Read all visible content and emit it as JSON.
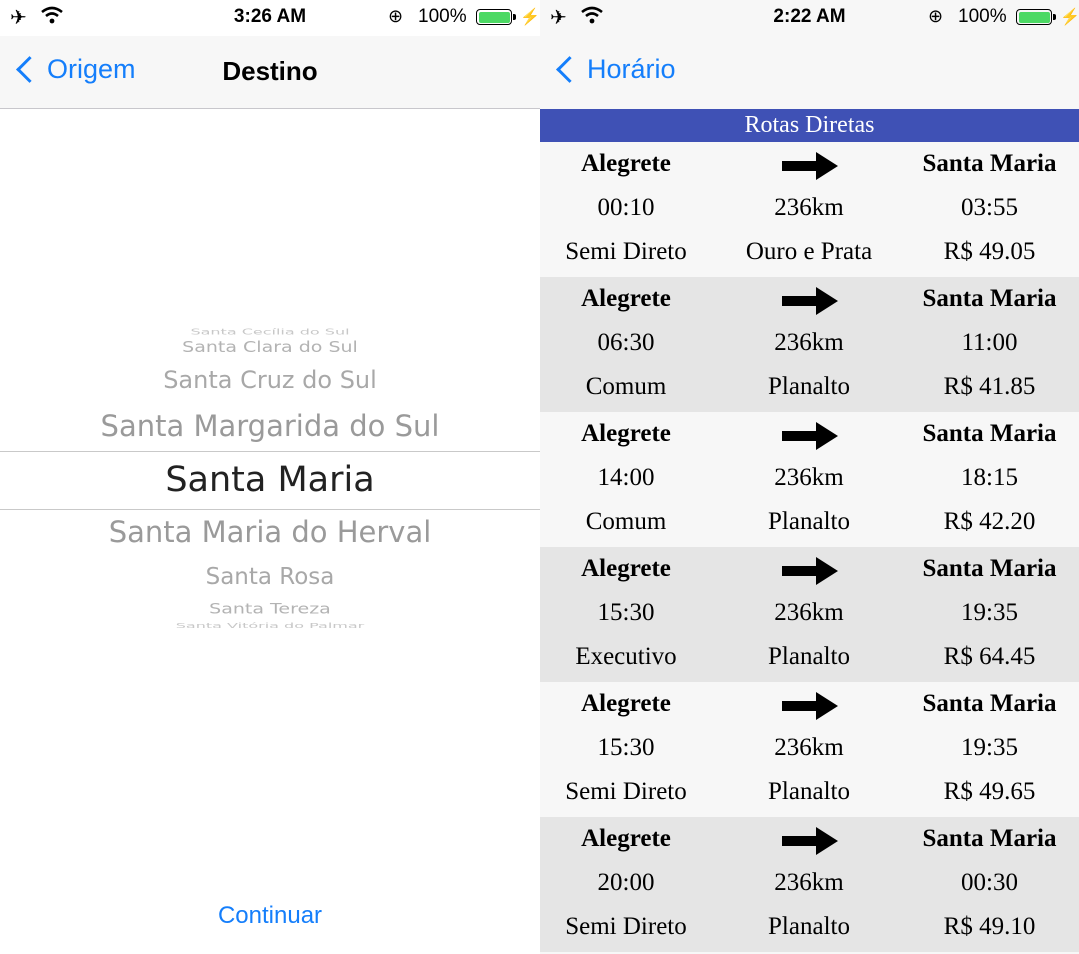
{
  "left": {
    "status": {
      "time": "3:26 AM",
      "battery": "100%"
    },
    "nav": {
      "back_label": "Origem",
      "title": "Destino"
    },
    "picker": {
      "items": [
        "Santa Cecília do Sul",
        "Santa Clara do Sul",
        "Santa Cruz do Sul",
        "Santa Margarida do Sul",
        "Santa Maria",
        "Santa Maria do Herval",
        "Santa Rosa",
        "Santa Tereza",
        "Santa Vitória do Palmar"
      ],
      "selected": "Santa Maria"
    },
    "continue_label": "Continuar"
  },
  "right": {
    "status": {
      "time": "2:22 AM",
      "battery": "100%"
    },
    "nav": {
      "back_label": "Horário"
    },
    "header": "Rotas Diretas",
    "routes": [
      {
        "origin": "Alegrete",
        "destination": "Santa Maria",
        "depart": "00:10",
        "distance": "236km",
        "arrive": "03:55",
        "type": "Semi Direto",
        "company": "Ouro e Prata",
        "price": "R$ 49.05"
      },
      {
        "origin": "Alegrete",
        "destination": "Santa Maria",
        "depart": "06:30",
        "distance": "236km",
        "arrive": "11:00",
        "type": "Comum",
        "company": "Planalto",
        "price": "R$ 41.85"
      },
      {
        "origin": "Alegrete",
        "destination": "Santa Maria",
        "depart": "14:00",
        "distance": "236km",
        "arrive": "18:15",
        "type": "Comum",
        "company": "Planalto",
        "price": "R$ 42.20"
      },
      {
        "origin": "Alegrete",
        "destination": "Santa Maria",
        "depart": "15:30",
        "distance": "236km",
        "arrive": "19:35",
        "type": "Executivo",
        "company": "Planalto",
        "price": "R$ 64.45"
      },
      {
        "origin": "Alegrete",
        "destination": "Santa Maria",
        "depart": "15:30",
        "distance": "236km",
        "arrive": "19:35",
        "type": "Semi Direto",
        "company": "Planalto",
        "price": "R$ 49.65"
      },
      {
        "origin": "Alegrete",
        "destination": "Santa Maria",
        "depart": "20:00",
        "distance": "236km",
        "arrive": "00:30",
        "type": "Semi Direto",
        "company": "Planalto",
        "price": "R$ 49.10"
      }
    ]
  },
  "colors": {
    "accent": "#147efb",
    "header_bar": "#3f51b5",
    "battery": "#4cd964"
  }
}
